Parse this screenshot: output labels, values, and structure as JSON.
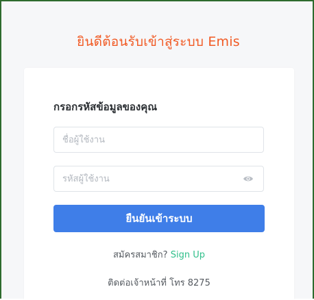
{
  "header": {
    "welcome_text": "ยินดีต้อนรับเข้าสู่ระบบ Emis"
  },
  "form": {
    "title": "กรอกรหัสข้อมูลของคุณ",
    "username": {
      "placeholder": "ชื่อผู้ใช้งาน",
      "value": ""
    },
    "password": {
      "placeholder": "รหัสผู้ใช้งาน",
      "value": "",
      "toggle_icon": "eye-icon"
    },
    "submit_label": "ยืนยันเข้าระบบ"
  },
  "footer": {
    "signup_prompt": "สมัครสมาชิก?",
    "signup_link": "Sign Up",
    "contact_text": "ติดต่อเจ้าหน้าที่ โทร 8275"
  },
  "colors": {
    "welcome": "#f15a24",
    "button": "#3f7ee8",
    "link": "#2fbf8a",
    "frame_border": "#2e6b2e"
  }
}
